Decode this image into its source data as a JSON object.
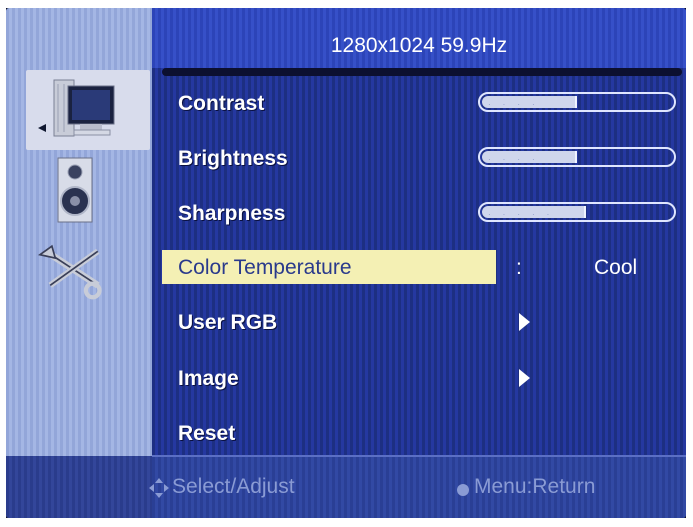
{
  "header": {
    "resolution": "1280x1024 59.9Hz"
  },
  "sidebar": {
    "icons": [
      "monitor-icon",
      "speaker-icon",
      "tools-icon"
    ],
    "selected": "monitor-icon"
  },
  "menu": {
    "items": [
      {
        "label": "Contrast",
        "type": "slider",
        "level": 0.5
      },
      {
        "label": "Brightness",
        "type": "slider",
        "level": 0.5
      },
      {
        "label": "Sharpness",
        "type": "slider",
        "level": 0.55
      },
      {
        "label": "Color Temperature",
        "type": "value",
        "separator": ":",
        "value": "Cool",
        "selected": true
      },
      {
        "label": "User RGB",
        "type": "submenu"
      },
      {
        "label": "Image",
        "type": "submenu"
      },
      {
        "label": "Reset",
        "type": "action"
      }
    ]
  },
  "footer": {
    "left": "Select/Adjust",
    "right": "Menu:Return",
    "left_icon": "move-arrows-icon",
    "right_icon": "dot-icon"
  },
  "colors": {
    "panel": "#1d2f82",
    "header": "#3650c8",
    "sidebar": "#a4b6e4",
    "highlight": "#f4f0b4",
    "footer_text": "#8a9bd4"
  }
}
